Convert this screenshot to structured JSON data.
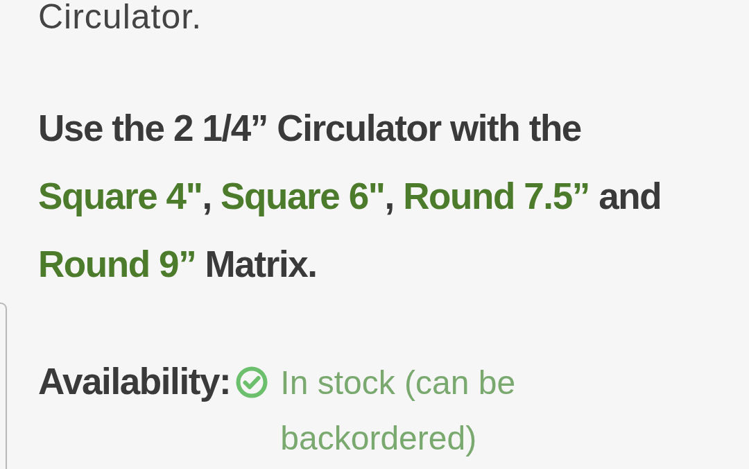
{
  "intro_tail": "Circulator.",
  "compatibility": {
    "segments": [
      {
        "kind": "text",
        "text": "Use the 2 1/4” Circulator with the "
      },
      {
        "kind": "link",
        "text": "Square 4\""
      },
      {
        "kind": "text",
        "text": ", "
      },
      {
        "kind": "link",
        "text": "Square 6\""
      },
      {
        "kind": "text",
        "text": ", "
      },
      {
        "kind": "link",
        "text": "Round 7.5”"
      },
      {
        "kind": "text",
        "text": " and "
      },
      {
        "kind": "link",
        "text": "Round 9”"
      },
      {
        "kind": "text",
        "text": " Matrix."
      }
    ]
  },
  "availability": {
    "label": "Availability:",
    "in_stock": true,
    "status": "In stock (can be backordered)"
  }
}
